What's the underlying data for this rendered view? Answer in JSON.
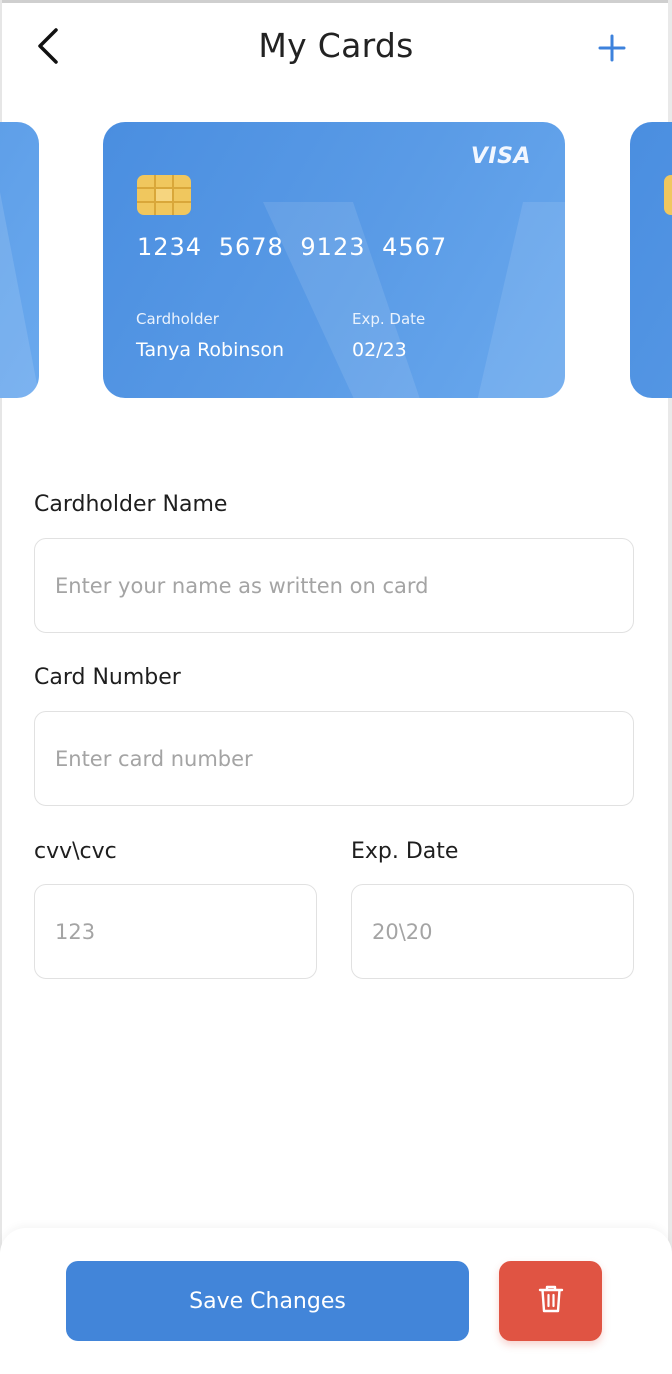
{
  "header": {
    "title": "My Cards",
    "back_icon": "chevron-left-icon",
    "add_icon": "plus-icon"
  },
  "cards": {
    "main": {
      "brand": "VISA",
      "number": "1234 5678 9123 4567",
      "holder_label": "Cardholder",
      "holder_name": "Tanya Robinson",
      "exp_label": "Exp. Date",
      "exp_value": "02/23"
    }
  },
  "form": {
    "name_label": "Cardholder Name",
    "name_placeholder": "Enter your name as written on card",
    "number_label": "Card Number",
    "number_placeholder": "Enter card number",
    "cvv_label": "cvv\\cvc",
    "cvv_placeholder": "123",
    "exp_label": "Exp. Date",
    "exp_placeholder": "20\\20"
  },
  "actions": {
    "save_label": "Save Changes",
    "delete_icon": "trash-icon"
  },
  "colors": {
    "accent": "#4285d9",
    "card": "#4a8ee0",
    "danger": "#e05443",
    "chip": "#f0c75e"
  }
}
